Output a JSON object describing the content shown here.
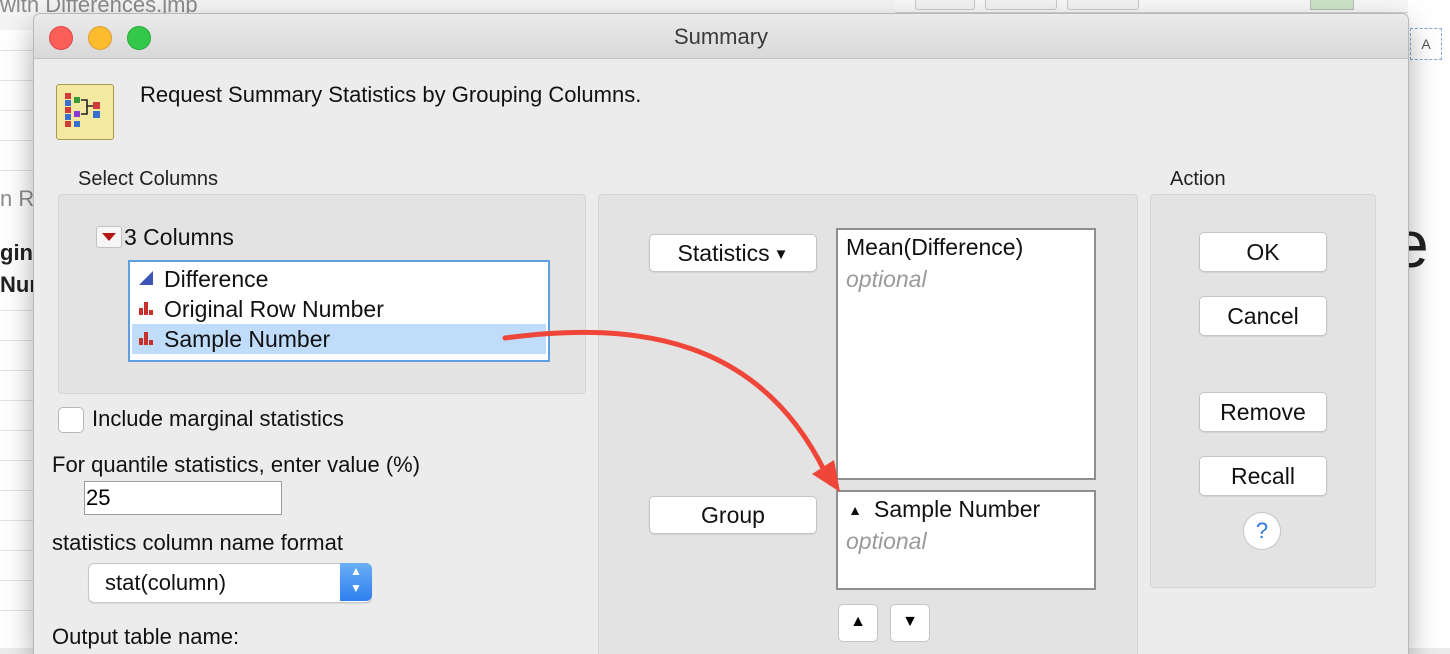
{
  "background_window": {
    "title": "with Differences.jmp",
    "col_header_partial": "n Ro",
    "row_label_1": "gin",
    "row_label_2": "Nur",
    "big_letter": "e",
    "a_icon": "A"
  },
  "dialog": {
    "title": "Summary",
    "icon": "summary-platform-icon",
    "heading": "Request Summary Statistics by Grouping Columns."
  },
  "select_columns": {
    "label": "Select Columns",
    "count_label": "3 Columns",
    "columns": [
      {
        "name": "Difference",
        "type": "continuous",
        "selected": false
      },
      {
        "name": "Original Row Number",
        "type": "nominal",
        "selected": false
      },
      {
        "name": "Sample Number",
        "type": "nominal",
        "selected": true
      }
    ]
  },
  "options": {
    "marginal_label": "Include marginal statistics",
    "marginal_checked": false,
    "quantile_label": "For quantile statistics, enter value (%)",
    "quantile_value": "25",
    "name_format_label": "statistics column name format",
    "name_format_value": "stat(column)",
    "output_label": "Output table name:"
  },
  "roles": {
    "statistics_button": "Statistics",
    "statistics_items": [
      "Mean(Difference)"
    ],
    "statistics_optional": "optional",
    "group_button": "Group",
    "group_items": [
      "Sample Number"
    ],
    "group_optional": "optional",
    "sort_ascending_icon": "sort-ascending-icon",
    "sort_descending_icon": "sort-descending-icon"
  },
  "action": {
    "label": "Action",
    "ok": "OK",
    "cancel": "Cancel",
    "remove": "Remove",
    "recall": "Recall",
    "help": "?"
  },
  "annotation": {
    "arrow_color": "#f0463a"
  }
}
